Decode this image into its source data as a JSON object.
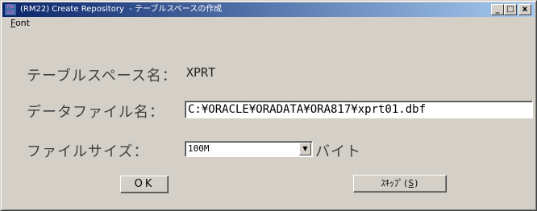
{
  "window": {
    "title": "(RM22) Create Repository  - テーブルスペースの作成",
    "icon_text": "Pla sQl",
    "controls": {
      "minimize": "_",
      "maximize": "□",
      "close": "x"
    }
  },
  "menu": {
    "font_label": "ont",
    "font_mnemonic": "F"
  },
  "form": {
    "tablespace_label": "テーブルスペース名：",
    "tablespace_value": "XPRT",
    "datafile_label": "データファイル名：",
    "datafile_value": "C:¥ORACLE¥ORADATA¥ORA817¥xprt01.dbf",
    "filesize_label": "ファイルサイズ：",
    "filesize_value": "100M",
    "filesize_unit": "バイト"
  },
  "buttons": {
    "ok_label": "OK",
    "skip_label_prefix": "ｽｷｯﾌﾟ(",
    "skip_mnemonic": "S",
    "skip_label_suffix": ")"
  },
  "icons": {
    "app": "application-icon",
    "dropdown": "chevron-down-icon"
  }
}
